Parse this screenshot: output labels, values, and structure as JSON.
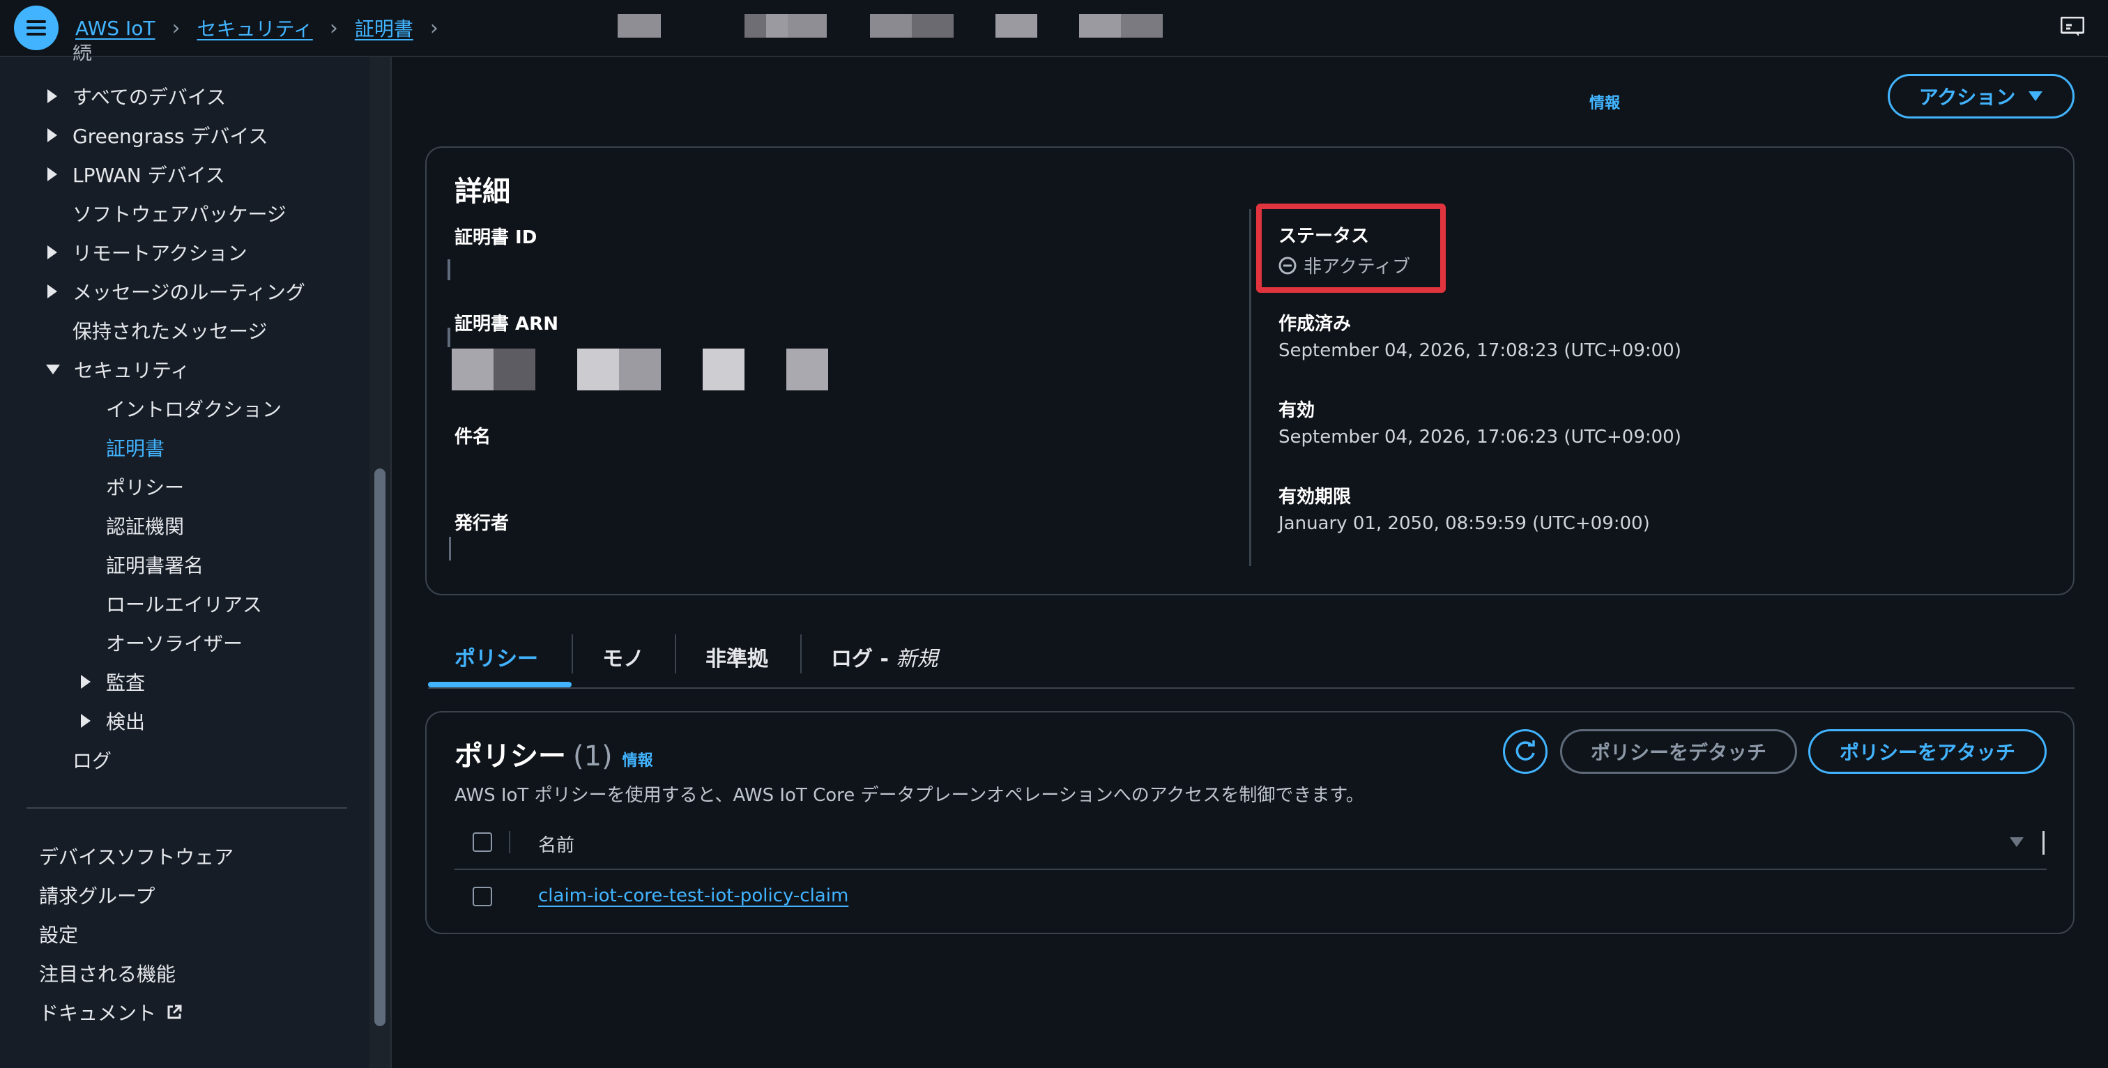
{
  "topbar": {
    "breadcrumbs": [
      "AWS IoT",
      "セキュリティ",
      "証明書"
    ]
  },
  "sidebar": {
    "truncated_top": "続",
    "items": [
      "すべてのデバイス",
      "Greengrass デバイス",
      "LPWAN デバイス",
      "ソフトウェアパッケージ",
      "リモートアクション",
      "メッセージのルーティング",
      "保持されたメッセージ",
      "セキュリティ",
      "イントロダクション",
      "証明書",
      "ポリシー",
      "認証機関",
      "証明書署名",
      "ロールエイリアス",
      "オーソライザー",
      "監査",
      "検出",
      "ログ"
    ],
    "footer_items": [
      "デバイスソフトウェア",
      "請求グループ",
      "設定",
      "注目される機能",
      "ドキュメント"
    ]
  },
  "header": {
    "info_link": "情報",
    "actions_label": "アクション"
  },
  "details": {
    "title": "詳細",
    "cert_id_label": "証明書 ID",
    "cert_arn_label": "証明書 ARN",
    "subject_label": "件名",
    "issuer_label": "発行者",
    "status_label": "ステータス",
    "status_value": "非アクティブ",
    "created_label": "作成済み",
    "created_value": "September 04, 2026, 17:08:23 (UTC+09:00)",
    "valid_label": "有効",
    "valid_value": "September 04, 2026, 17:06:23 (UTC+09:00)",
    "expiry_label": "有効期限",
    "expiry_value": "January 01, 2050, 08:59:59 (UTC+09:00)"
  },
  "tabs": {
    "policies": "ポリシー",
    "things": "モノ",
    "noncompliant": "非準拠",
    "logs": "ログ - ",
    "logs_new": "新規"
  },
  "policies": {
    "title": "ポリシー",
    "count": "(1)",
    "info": "情報",
    "description": "AWS IoT ポリシーを使用すると、AWS IoT Core データプレーンオペレーションへのアクセスを制御できます。",
    "detach_label": "ポリシーをデタッチ",
    "attach_label": "ポリシーをアタッチ",
    "column_name": "名前",
    "rows": [
      {
        "name": "claim-iot-core-test-iot-policy-claim"
      }
    ]
  },
  "colors": {
    "accent": "#42b4ff",
    "highlight": "#e0343e",
    "background": "#0f141a",
    "sidebar": "#161d26"
  }
}
